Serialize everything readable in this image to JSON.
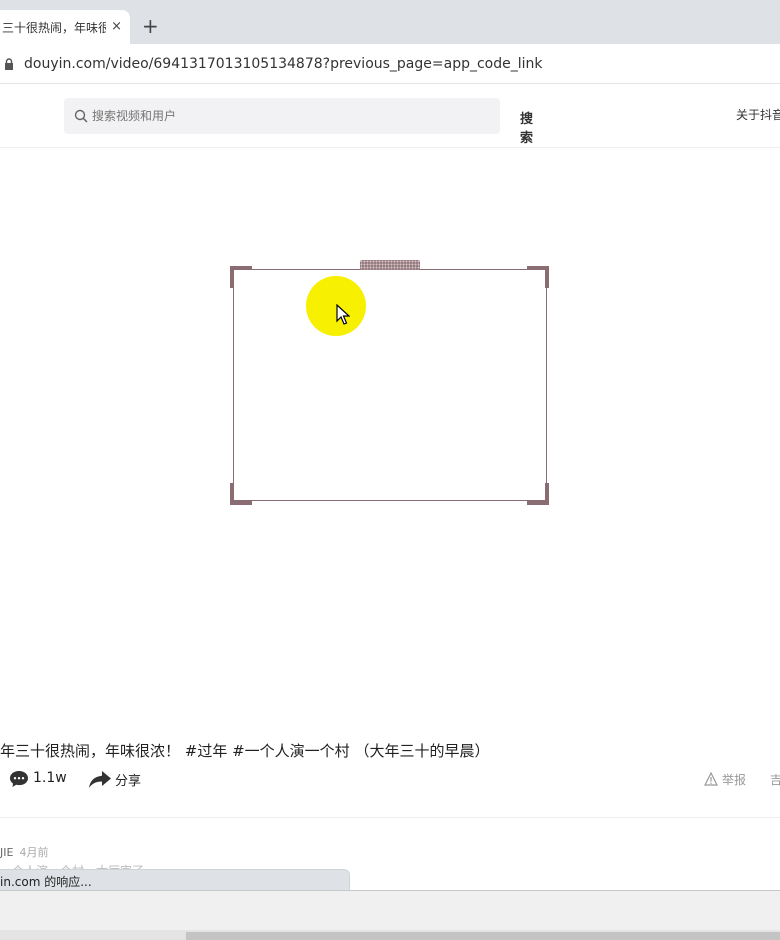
{
  "browser": {
    "tab_title": "三十很热闹，年味很浓",
    "tab_close": "×",
    "new_tab": "+",
    "url": "douyin.com/video/6941317013105134878?previous_page=app_code_link",
    "status_text": "in.com 的响应..."
  },
  "header": {
    "search_placeholder": "搜索视频和用户",
    "search_button": "搜索",
    "about": "关于抖音"
  },
  "video": {
    "caption": "年三十很热闹，年味很浓！ #过年 #一个人演一个村 （大年三十的早晨）",
    "comment_count": "1.1w",
    "share_label": "分享",
    "report_label": "举报",
    "more": "吉"
  },
  "comment": {
    "author": "JIE",
    "time": "4月前",
    "text": "一个人演一个村，太厉害了"
  },
  "colors": {
    "frame": "#8a6d72",
    "highlight": "#f7f000"
  }
}
